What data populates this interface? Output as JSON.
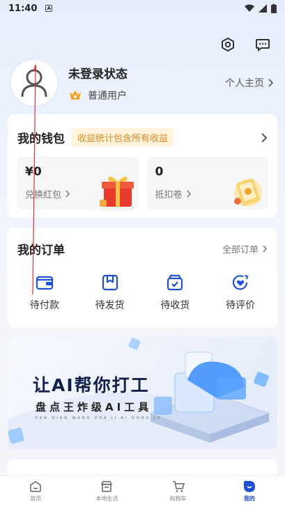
{
  "status": {
    "time": "11:40",
    "notif_letter": "A"
  },
  "profile": {
    "login_status": "未登录状态",
    "user_level": "普通用户",
    "homepage_link": "个人主页"
  },
  "wallet": {
    "title": "我的钱包",
    "tag": "收益统计包含所有收益",
    "boxes": [
      {
        "amount": "¥0",
        "label": "兑换红包"
      },
      {
        "amount": "0",
        "label": "抵扣卷"
      }
    ]
  },
  "orders": {
    "title": "我的订单",
    "all_link": "全部订单",
    "items": [
      {
        "label": "待付款",
        "icon": "wallet-icon"
      },
      {
        "label": "待发货",
        "icon": "package-icon"
      },
      {
        "label": "待收货",
        "icon": "receive-box-icon"
      },
      {
        "label": "待评价",
        "icon": "review-heart-icon"
      }
    ]
  },
  "banner": {
    "title": "让AI帮你打工",
    "subtitle": "盘点王炸级AI工具",
    "pinyin": "PAN DIAN WANG ZHA JI AI GONG JU"
  },
  "tabbar": {
    "tabs": [
      {
        "label": "首页",
        "icon": "home-icon"
      },
      {
        "label": "本地生活",
        "icon": "shop-icon"
      },
      {
        "label": "购物车",
        "icon": "cart-icon"
      },
      {
        "label": "我的",
        "icon": "me-icon",
        "active": true
      }
    ]
  },
  "colors": {
    "accent": "#1d4fd8",
    "tag_bg": "#fff3dc",
    "tag_text": "#e08a1e"
  }
}
